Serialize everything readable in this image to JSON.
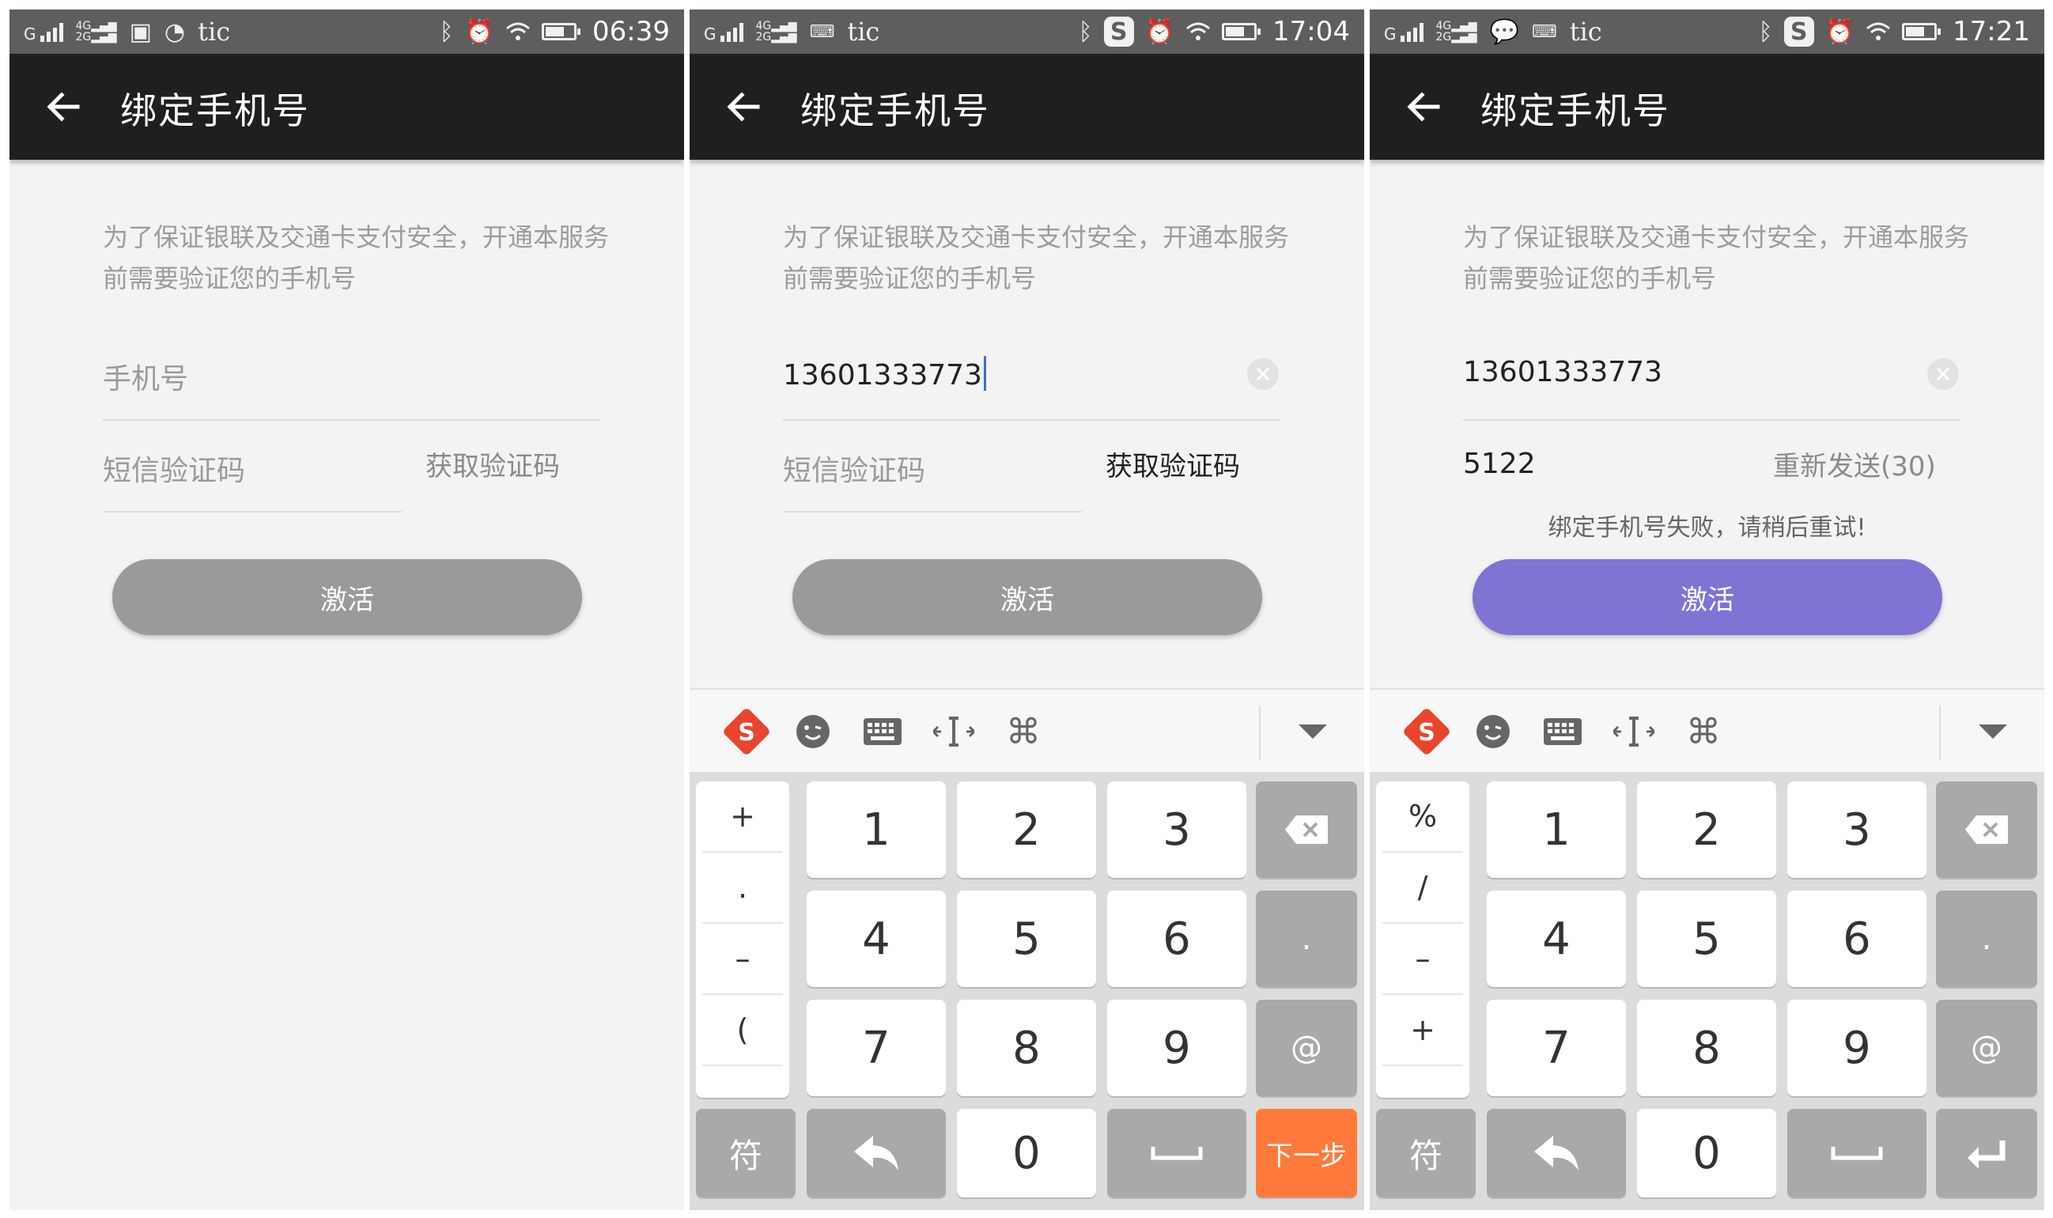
{
  "app_bar_title": "绑定手机号",
  "intro_text": "为了保证银联及交通卡支付安全，开通本服务前需要验证您的手机号",
  "phone_placeholder": "手机号",
  "code_placeholder": "短信验证码",
  "get_code_label": "获取验证码",
  "activate_label": "激活",
  "status": {
    "app_label": "tic"
  },
  "screens": [
    {
      "time": "06:39",
      "phone_value": "",
      "code_value": "",
      "resend_label": "",
      "error": "",
      "button_state": "disabled",
      "button_color": "#9a9a9a",
      "get_code_color": "#8a8a8a"
    },
    {
      "time": "17:04",
      "phone_value": "13601333773",
      "code_value": "",
      "resend_label": "",
      "error": "",
      "button_state": "disabled",
      "button_color": "#9a9a9a",
      "get_code_color": "#222222"
    },
    {
      "time": "17:21",
      "phone_value": "13601333773",
      "code_value": "5122",
      "resend_label": "重新发送(30)",
      "error": "绑定手机号失败，请稍后重试!",
      "button_state": "enabled",
      "button_color": "#7f73d4",
      "get_code_color": "#8a8a8a"
    }
  ],
  "keyboard": {
    "toolbar": [
      "sogou-logo",
      "emoji",
      "keyboard",
      "cursor-move",
      "command",
      "collapse"
    ],
    "digits": [
      "1",
      "2",
      "3",
      "4",
      "5",
      "6",
      "7",
      "8",
      "9",
      "0"
    ],
    "symbols_screen2": [
      "+",
      ".",
      "–",
      "(",
      "、"
    ],
    "symbols_screen3": [
      "%",
      "/",
      "–",
      "+"
    ],
    "right_keys": [
      ".",
      "@"
    ],
    "symbols_key": "符",
    "next_label": "下一步"
  }
}
